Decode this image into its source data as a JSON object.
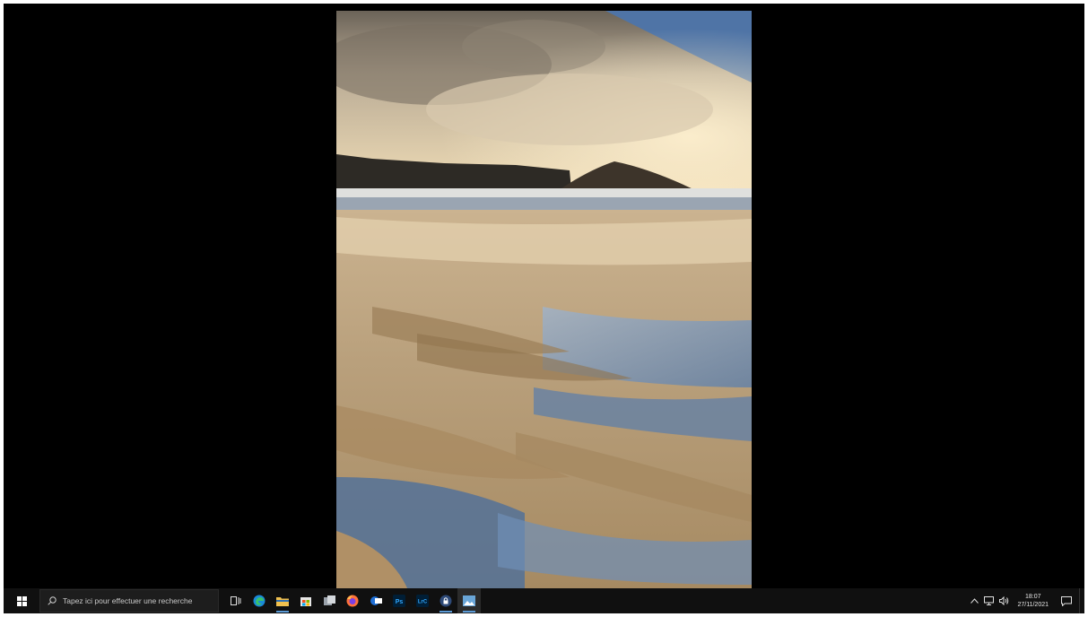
{
  "screen": {
    "background": "#000000"
  },
  "photo": {
    "subject": "beach-landscape-image"
  },
  "taskbar": {
    "background": "#101010",
    "search": {
      "placeholder": "Tapez ici pour effectuer une recherche"
    },
    "apps": [
      {
        "name": "task-view",
        "icon": "task-view-icon"
      },
      {
        "name": "edge",
        "icon": "edge-icon"
      },
      {
        "name": "file-explorer",
        "icon": "folder-icon",
        "running": true
      },
      {
        "name": "store",
        "icon": "store-icon"
      },
      {
        "name": "app-gray",
        "icon": "app-icon"
      },
      {
        "name": "firefox",
        "icon": "firefox-icon"
      },
      {
        "name": "app-blue",
        "icon": "app-icon"
      },
      {
        "name": "photoshop",
        "icon": "photoshop-icon",
        "label": "Ps"
      },
      {
        "name": "lightroom",
        "icon": "lightroom-icon",
        "label": "LrC"
      },
      {
        "name": "vpn",
        "icon": "lock-icon",
        "running": true
      },
      {
        "name": "photos",
        "icon": "photos-icon",
        "active": true,
        "running": true
      }
    ],
    "clock": {
      "time": "18:07",
      "date": "27/11/2021"
    },
    "accent": "#5a9ad6"
  }
}
